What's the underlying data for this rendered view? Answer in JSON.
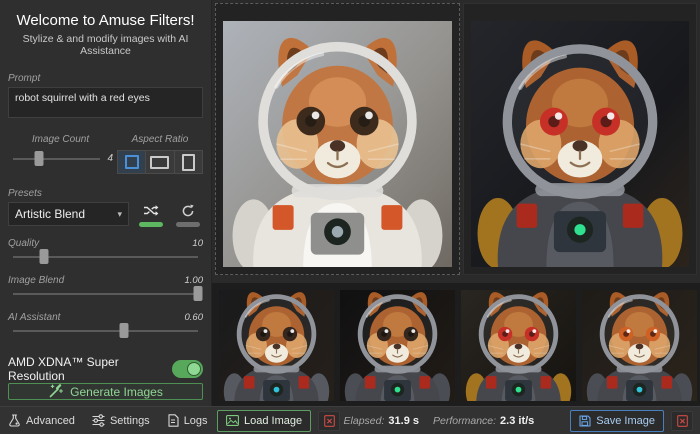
{
  "sidebar": {
    "title": "Welcome to Amuse Filters!",
    "subtitle": "Stylize & and modify images with AI Assistance",
    "prompt": {
      "label": "Prompt",
      "value": "robot squirrel with a red eyes"
    },
    "image_count": {
      "label": "Image Count",
      "value": "4",
      "percent": 30
    },
    "aspect_ratio": {
      "label": "Aspect Ratio",
      "options": [
        "square",
        "landscape",
        "portrait"
      ],
      "selected": "square"
    },
    "presets": {
      "label": "Presets",
      "selected": "Artistic Blend"
    },
    "sliders": [
      {
        "label": "Quality",
        "value": "10",
        "percent": 17
      },
      {
        "label": "Image Blend",
        "value": "1.00",
        "percent": 100
      },
      {
        "label": "AI Assistant",
        "value": "0.60",
        "percent": 60
      }
    ],
    "super_resolution": {
      "label": "AMD XDNA™ Super Resolution",
      "enabled": true
    },
    "generate_label": "Generate Images"
  },
  "gallery": {
    "source_alt": "squirrel in white astronaut suit",
    "result_alt": "robot squirrel with red eyes in dark space suit",
    "thumbnails": [
      {
        "alt": "robot squirrel variant 1"
      },
      {
        "alt": "robot squirrel variant 2"
      },
      {
        "alt": "robot squirrel variant 3"
      },
      {
        "alt": "robot squirrel variant 4"
      }
    ]
  },
  "footer": {
    "advanced": "Advanced",
    "settings": "Settings",
    "logs": "Logs",
    "load_image": "Load Image",
    "save_image": "Save Image",
    "elapsed_label": "Elapsed:",
    "elapsed_value": "31.9 s",
    "performance_label": "Performance:",
    "performance_value": "2.3 it/s"
  },
  "icons": {
    "shuffle": "crossed-arrows",
    "refresh": "circular-arrows",
    "generate": "magic-wand",
    "advanced": "beaker",
    "settings": "sliders",
    "logs": "document",
    "info": "i",
    "load": "image",
    "save": "floppy-disk",
    "delete": "image-x"
  },
  "colors": {
    "accent_green": "#5db761",
    "accent_blue": "#4f86c9",
    "accent_red": "#c9413a",
    "aspect_selected_blue": "#4a90d9"
  }
}
